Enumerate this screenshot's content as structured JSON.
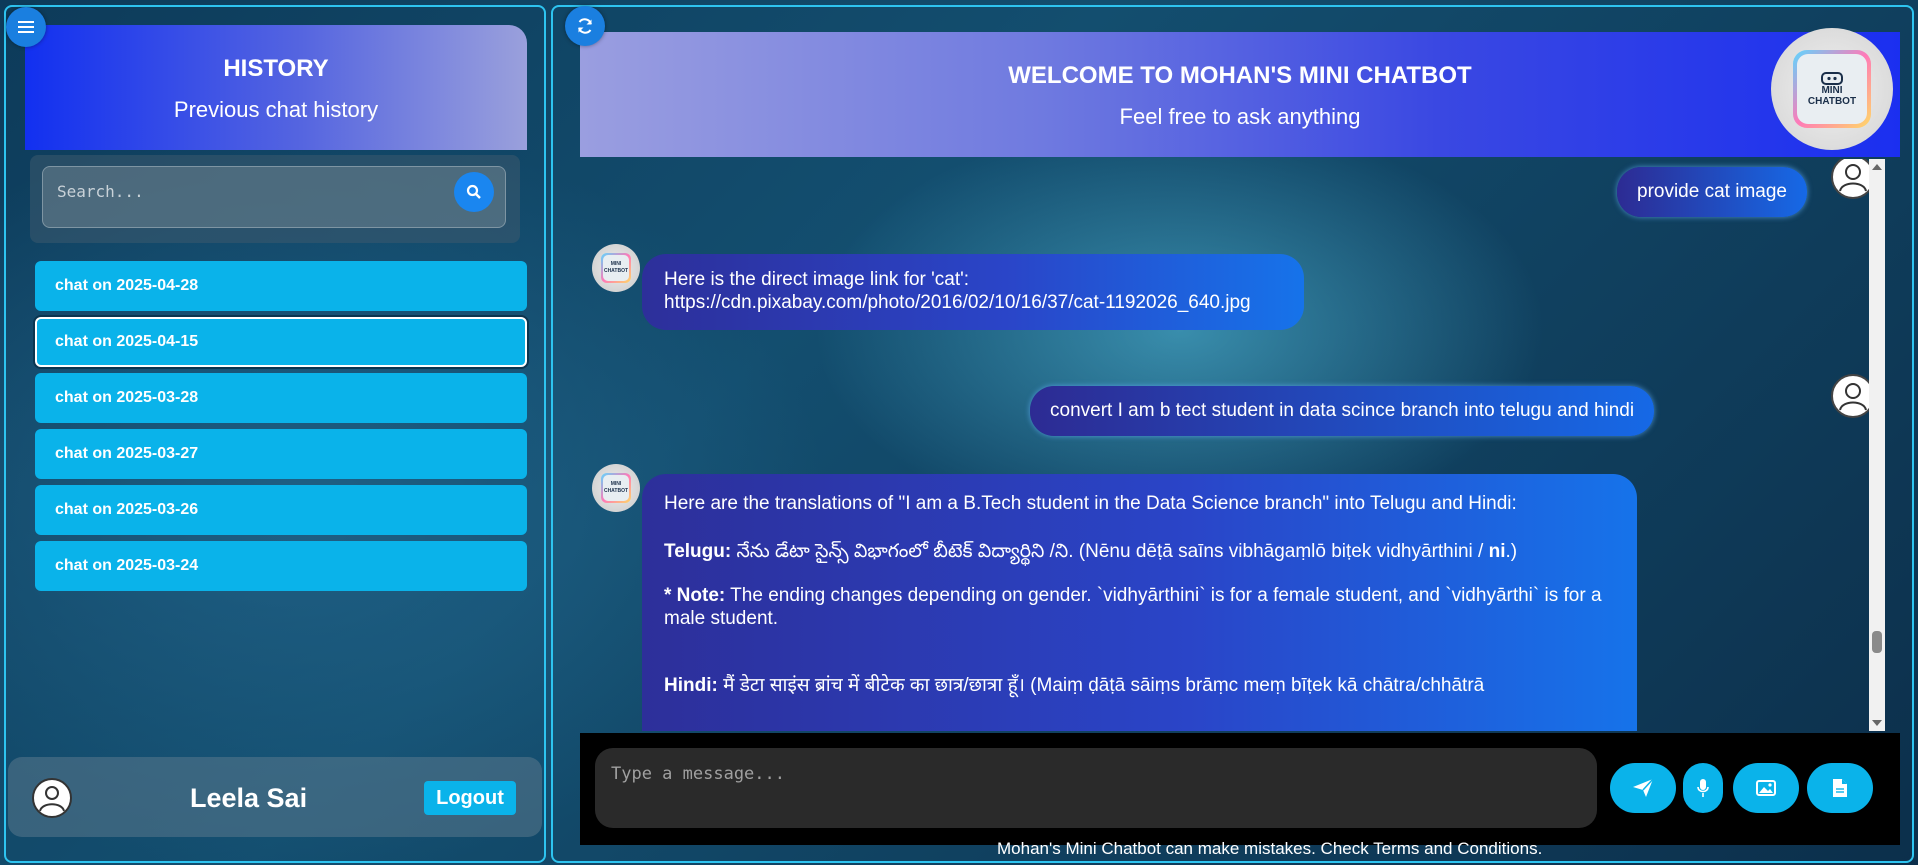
{
  "sidebar": {
    "title": "HISTORY",
    "subtitle": "Previous chat history",
    "search": {
      "placeholder": "Search..."
    },
    "chats": [
      {
        "label": "chat on 2025-04-28"
      },
      {
        "label": "chat on 2025-04-15",
        "active": true
      },
      {
        "label": "chat on 2025-03-28"
      },
      {
        "label": "chat on 2025-03-27"
      },
      {
        "label": "chat on 2025-03-26"
      },
      {
        "label": "chat on 2025-03-24"
      }
    ],
    "user": {
      "name": "Leela Sai",
      "logout_label": "Logout"
    }
  },
  "header": {
    "title": "WELCOME TO MOHAN'S MINI CHATBOT",
    "subtitle": "Feel free to ask anything",
    "logo_text_1": "MINI",
    "logo_text_2": "CHATBOT"
  },
  "messages": {
    "user1": "provide cat image",
    "bot1_line1": "Here is the direct image link for 'cat':",
    "bot1_line2": "https://cdn.pixabay.com/photo/2016/02/10/16/37/cat-1192026_640.jpg",
    "user2": "convert I am b tect student in data scince branch into telugu and hindi",
    "bot2_intro": "Here are the translations of \"I am a B.Tech student in the Data Science branch\" into Telugu and Hindi:",
    "bot2_telugu_label": "Telugu:",
    "bot2_telugu_text": "నేను డేటా సైన్స్ విభాగంలో బీటెక్ విద్యార్థిని /ని. (Nēnu dēṭā saīns vibhāgaṃlō biṭek vidhyārthini /",
    "bot2_telugu_end": "ni",
    "bot2_note_label": "* Note:",
    "bot2_note_text": "The ending changes depending on gender. `vidhyārthini` is for a female student, and `vidhyārthi` is for a male student.",
    "bot2_hindi_label": "Hindi:",
    "bot2_hindi_text": "मैं डेटा साइंस ब्रांच में बीटेक का छात्र/छात्रा हूँ। (Maiṃ ḍāṭā sāiṃs brāṃc meṃ bīṭek kā chātra/chhātrā"
  },
  "composer": {
    "placeholder": "Type a message..."
  },
  "footer": "Mohan's Mini Chatbot can make mistakes. Check Terms and Conditions.",
  "colors": {
    "accent": "#0ab3ea",
    "border": "#2ec4f0",
    "button_blue": "#1a7fe0"
  }
}
